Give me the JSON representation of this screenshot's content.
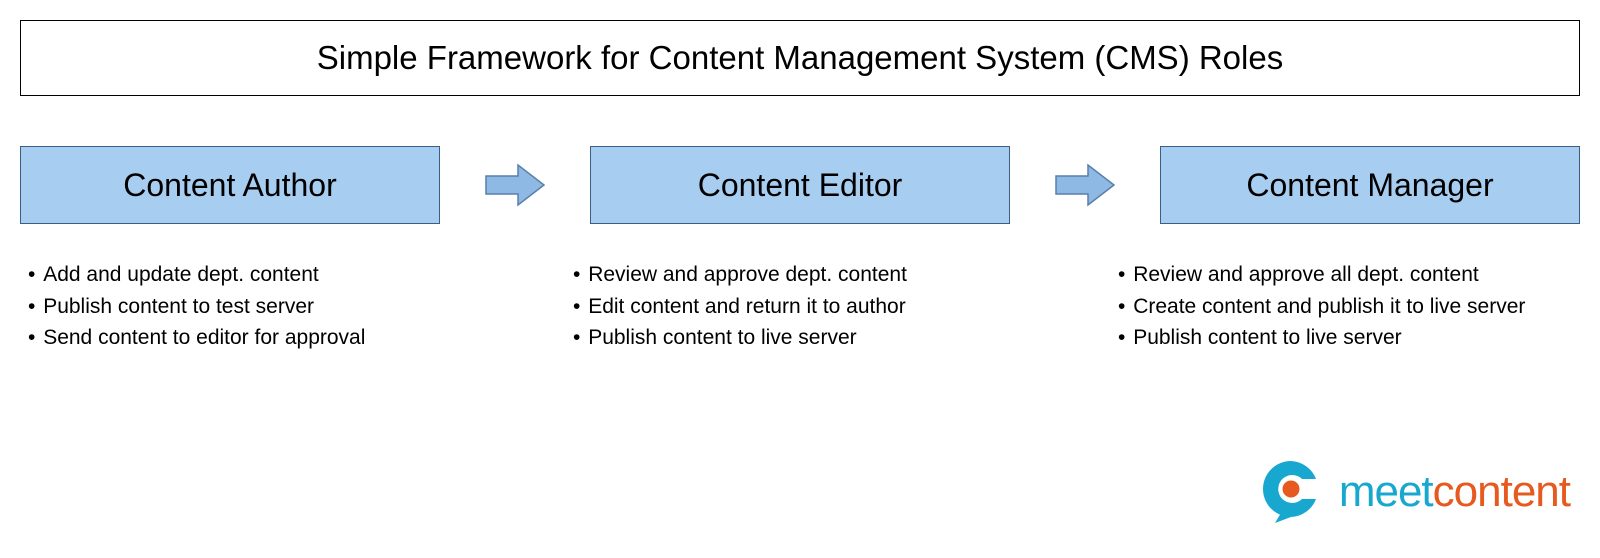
{
  "title": "Simple Framework for Content Management System (CMS) Roles",
  "roles": [
    {
      "name": "Content Author",
      "bullets": [
        "Add and update dept. content",
        "Publish content to test server",
        "Send content to editor for approval"
      ]
    },
    {
      "name": "Content Editor",
      "bullets": [
        "Review and approve dept. content",
        "Edit content and return it to author",
        "Publish content to live server"
      ]
    },
    {
      "name": "Content Manager",
      "bullets": [
        "Review and approve all dept. content",
        "Create content and publish it to live server",
        "Publish content to live server"
      ]
    }
  ],
  "logo": {
    "part1": "meet",
    "part2": "content",
    "icon_name": "meetcontent-logo-icon"
  },
  "colors": {
    "role_box_fill": "#a7cdf0",
    "role_box_border": "#3b5e82",
    "arrow_fill": "#8db9e4",
    "arrow_border": "#5a7fa8",
    "logo_cyan": "#18a8cf",
    "logo_orange": "#e65a1f"
  }
}
